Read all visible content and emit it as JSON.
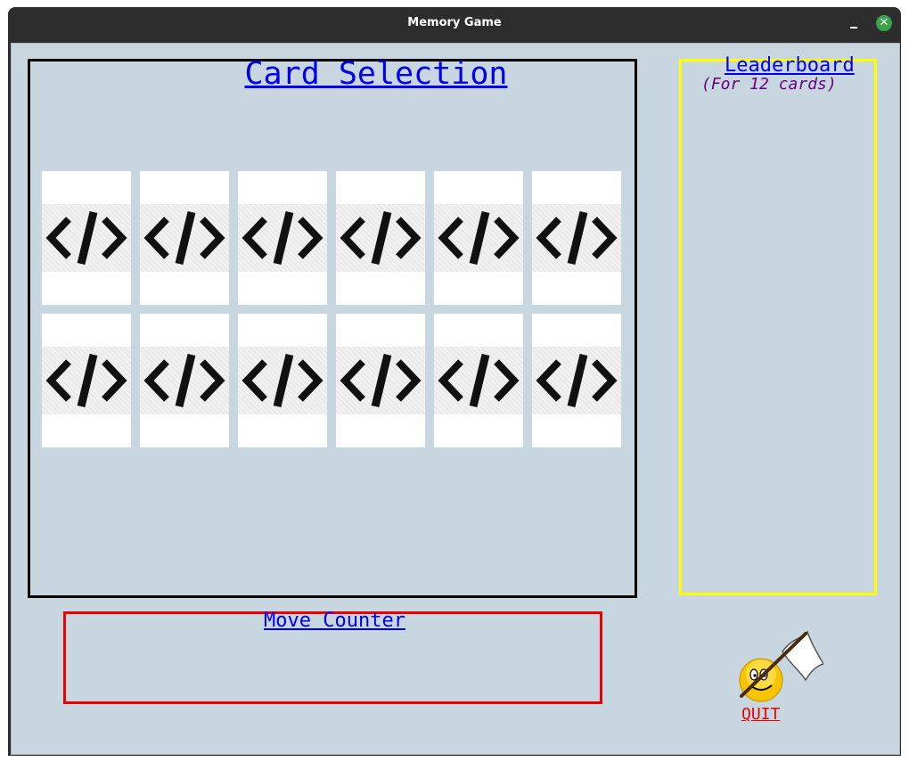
{
  "window": {
    "title": "Memory Game"
  },
  "card_selection": {
    "title": "Card Selection",
    "rows": 2,
    "columns": 6,
    "card_face_icon": "code-icon",
    "card_face_text": "</>"
  },
  "leaderboard": {
    "title": "Leaderboard",
    "subtitle": "(For 12 cards)"
  },
  "move_counter": {
    "title": "Move Counter"
  },
  "quit": {
    "label": "QUIT",
    "icon": "smiley-white-flag-icon"
  },
  "colors": {
    "background": "#c8d6e0",
    "card_panel_border": "#000000",
    "leaderboard_border": "#ffff00",
    "move_counter_border": "#ee0000",
    "heading_text": "#0000ee",
    "subtitle_text": "#6a0080",
    "quit_text": "#ee0000"
  }
}
